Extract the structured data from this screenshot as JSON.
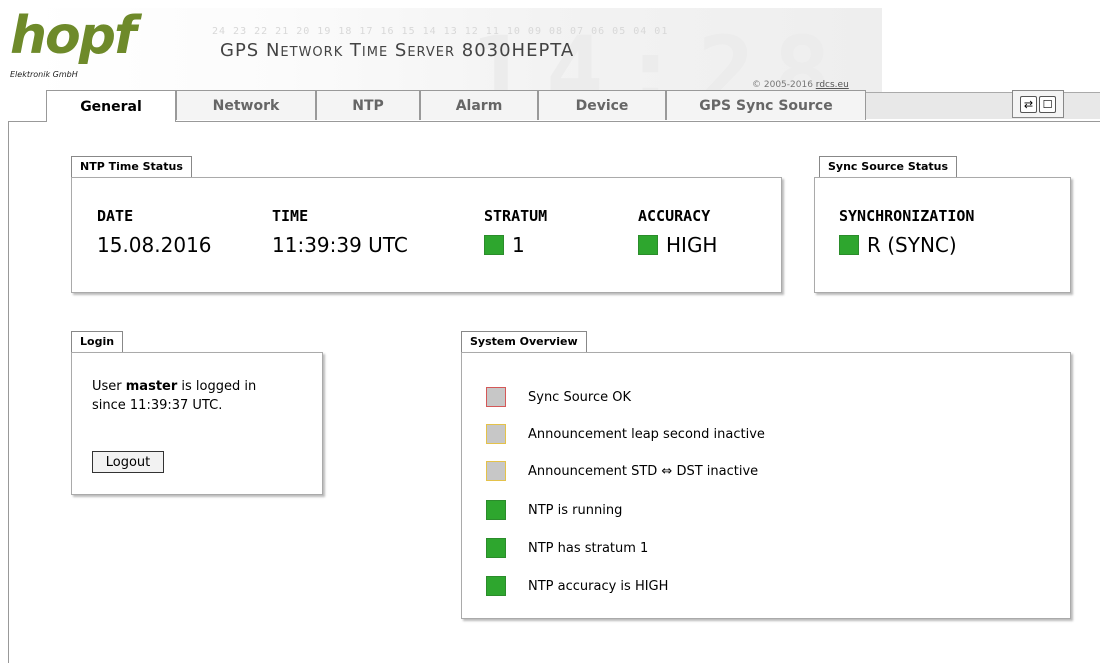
{
  "header": {
    "logo_text": "hopf",
    "logo_sub": "Elektronik  GmbH",
    "product_title": "GPS Network Time Server 8030HEPTA",
    "copyright_prefix": "© 2005-2016 ",
    "copyright_link": "rdcs.eu",
    "banner_digits": "24 23 22 21 20 19 18 17 16 15 14 13 12 11 10 09 08 07 06 05 04 01",
    "banner_clock": "14:28 15"
  },
  "tabs": [
    {
      "label": "General",
      "active": true
    },
    {
      "label": "Network",
      "active": false
    },
    {
      "label": "NTP",
      "active": false
    },
    {
      "label": "Alarm",
      "active": false
    },
    {
      "label": "Device",
      "active": false
    },
    {
      "label": "GPS Sync Source",
      "active": false
    }
  ],
  "tab_icons": {
    "refresh": "refresh-icon",
    "window": "window-icon"
  },
  "ntp_status": {
    "title": "NTP Time Status",
    "date_label": "DATE",
    "date_value": "15.08.2016",
    "time_label": "TIME",
    "time_value": "11:39:39 UTC",
    "stratum_label": "STRATUM",
    "stratum_value": "1",
    "accuracy_label": "ACCURACY",
    "accuracy_value": "HIGH"
  },
  "sync_status": {
    "title": "Sync Source Status",
    "sync_label": "SYNCHRONIZATION",
    "sync_value": "R (SYNC)"
  },
  "login": {
    "title": "Login",
    "line1_prefix": "User ",
    "user": "master",
    "line1_suffix": " is logged in",
    "line2": "since 11:39:37 UTC.",
    "logout_label": "Logout"
  },
  "overview": {
    "title": "System Overview",
    "items": [
      {
        "label": "Sync Source OK",
        "status": "red"
      },
      {
        "label": "Announcement leap second inactive",
        "status": "yellow"
      },
      {
        "label": "Announcement STD ⇔ DST inactive",
        "status": "yellow"
      },
      {
        "label": "NTP is running",
        "status": "green"
      },
      {
        "label": "NTP has stratum 1",
        "status": "green"
      },
      {
        "label": "NTP accuracy is HIGH",
        "status": "green"
      }
    ]
  },
  "colors": {
    "ok_green": "#2ea62e",
    "logo_green": "#6e8a2a"
  }
}
